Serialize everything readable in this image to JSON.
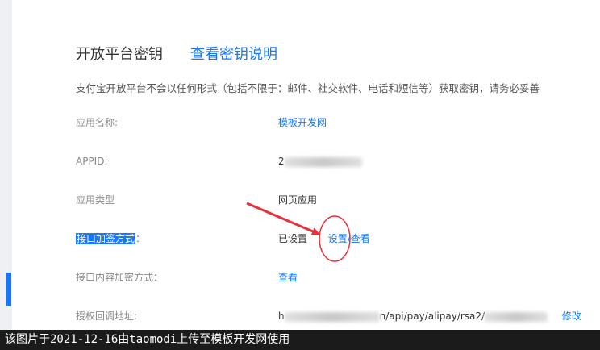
{
  "header": {
    "title": "开放平台密钥",
    "help_link": "查看密钥说明"
  },
  "notice": "支付宝开放平台不会以任何形式（包括不限于：邮件、社交软件、电话和短信等）获取密钥，请务必妥善",
  "rows": {
    "app_name": {
      "label": "应用名称:",
      "value": "模板开发网"
    },
    "appid": {
      "label": "APPID:",
      "value_prefix": "2",
      "value_suffix": "3"
    },
    "app_type": {
      "label": "应用类型",
      "value": "网页应用"
    },
    "sign_method": {
      "label": "接口加签方式",
      "label_suffix": "：",
      "status": "已设置",
      "set_link": "设置",
      "separator": "/",
      "view_link": "查看"
    },
    "content_encrypt": {
      "label": "接口内容加密方式：",
      "view_link": "查看"
    },
    "callback": {
      "label": "授权回调地址:",
      "url_prefix": "h",
      "url_visible": "n/api/pay/alipay/rsa2/",
      "edit_link": "修改"
    }
  },
  "watermark": "该图片于2021-12-16由taomodi上传至模板开发网使用",
  "colors": {
    "link": "#1677ff",
    "annotation": "#e8313b",
    "highlight": "#1677ff"
  }
}
